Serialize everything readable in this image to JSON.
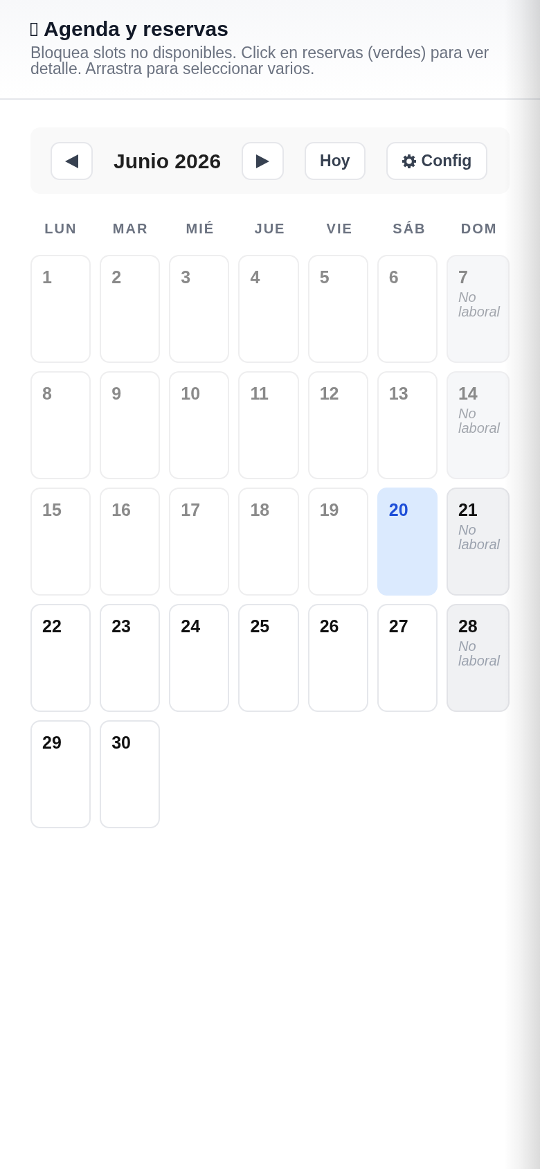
{
  "header": {
    "title": "Agenda y reservas",
    "subtitle": "Bloquea slots no disponibles. Click en reservas (verdes) para ver detalle. Arrastra para seleccionar varios."
  },
  "toolbar": {
    "month_label": "Junio 2026",
    "today_button": "Hoy",
    "config_button": "Config"
  },
  "calendar": {
    "weekdays": [
      "LUN",
      "MAR",
      "MIÉ",
      "JUE",
      "VIE",
      "SÁB",
      "DOM"
    ],
    "days": [
      {
        "day": "1",
        "past": true,
        "today": false,
        "non_working": false
      },
      {
        "day": "2",
        "past": true,
        "today": false,
        "non_working": false
      },
      {
        "day": "3",
        "past": true,
        "today": false,
        "non_working": false
      },
      {
        "day": "4",
        "past": true,
        "today": false,
        "non_working": false
      },
      {
        "day": "5",
        "past": true,
        "today": false,
        "non_working": false
      },
      {
        "day": "6",
        "past": true,
        "today": false,
        "non_working": false
      },
      {
        "day": "7",
        "past": true,
        "today": false,
        "non_working": true,
        "note": "No laboral"
      },
      {
        "day": "8",
        "past": true,
        "today": false,
        "non_working": false
      },
      {
        "day": "9",
        "past": true,
        "today": false,
        "non_working": false
      },
      {
        "day": "10",
        "past": true,
        "today": false,
        "non_working": false
      },
      {
        "day": "11",
        "past": true,
        "today": false,
        "non_working": false
      },
      {
        "day": "12",
        "past": true,
        "today": false,
        "non_working": false
      },
      {
        "day": "13",
        "past": true,
        "today": false,
        "non_working": false
      },
      {
        "day": "14",
        "past": true,
        "today": false,
        "non_working": true,
        "note": "No laboral"
      },
      {
        "day": "15",
        "past": true,
        "today": false,
        "non_working": false
      },
      {
        "day": "16",
        "past": true,
        "today": false,
        "non_working": false
      },
      {
        "day": "17",
        "past": true,
        "today": false,
        "non_working": false
      },
      {
        "day": "18",
        "past": true,
        "today": false,
        "non_working": false
      },
      {
        "day": "19",
        "past": true,
        "today": false,
        "non_working": false
      },
      {
        "day": "20",
        "past": false,
        "today": true,
        "non_working": false
      },
      {
        "day": "21",
        "past": false,
        "today": false,
        "non_working": true,
        "note": "No laboral"
      },
      {
        "day": "22",
        "past": false,
        "today": false,
        "non_working": false
      },
      {
        "day": "23",
        "past": false,
        "today": false,
        "non_working": false
      },
      {
        "day": "24",
        "past": false,
        "today": false,
        "non_working": false
      },
      {
        "day": "25",
        "past": false,
        "today": false,
        "non_working": false
      },
      {
        "day": "26",
        "past": false,
        "today": false,
        "non_working": false
      },
      {
        "day": "27",
        "past": false,
        "today": false,
        "non_working": false
      },
      {
        "day": "28",
        "past": false,
        "today": false,
        "non_working": true,
        "note": "No laboral"
      },
      {
        "day": "29",
        "past": false,
        "today": false,
        "non_working": false
      },
      {
        "day": "30",
        "past": false,
        "today": false,
        "non_working": false
      }
    ]
  }
}
